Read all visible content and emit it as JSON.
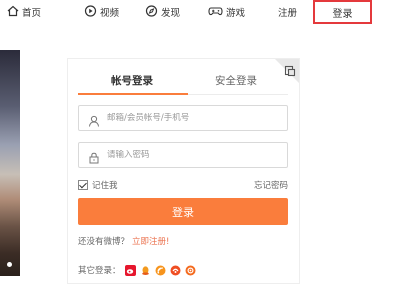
{
  "nav": {
    "home": "首页",
    "video": "视频",
    "discover": "发现",
    "game": "游戏",
    "register": "注册",
    "login": "登录"
  },
  "login": {
    "tab_account": "帐号登录",
    "tab_safe": "安全登录",
    "username_placeholder": "邮箱/会员帐号/手机号",
    "password_placeholder": "请输入密码",
    "remember": "记住我",
    "forgot": "忘记密码",
    "submit": "登录",
    "no_account": "还没有微博？",
    "register_now": "立即注册!",
    "other_login": "其它登录："
  },
  "social_icons": [
    "sina-weibo-icon",
    "qq-icon",
    "rss-icon",
    "baidu-icon",
    "taobao-icon"
  ],
  "colors": {
    "accent": "#fa7d3c",
    "highlight_border": "#e4393c",
    "link": "#eb7350"
  }
}
